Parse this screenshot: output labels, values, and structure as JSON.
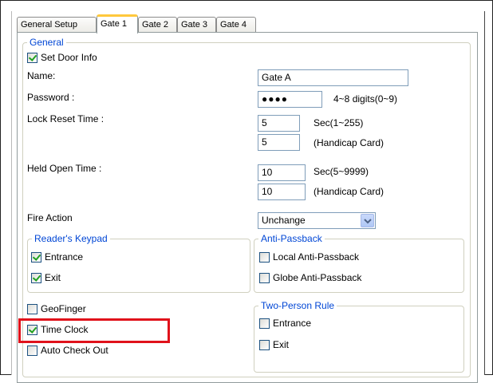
{
  "tabs": [
    "General Setup",
    "Gate 1",
    "Gate 2",
    "Gate 3",
    "Gate 4"
  ],
  "active_tab": "Gate 1",
  "general": {
    "title": "General",
    "set_door_info": {
      "label": "Set Door Info",
      "checked": true
    },
    "name": {
      "label": "Name:",
      "value": "Gate A"
    },
    "password": {
      "label": "Password :",
      "masked_value": "●●●●",
      "hint": "4~8 digits(0~9)"
    },
    "lock_reset": {
      "label": "Lock Reset Time :",
      "value": "5",
      "unit": "Sec(1~255)",
      "handicap_value": "5",
      "handicap_label": "(Handicap Card)"
    },
    "held_open": {
      "label": "Held Open Time :",
      "value": "10",
      "unit": "Sec(5~9999)",
      "handicap_value": "10",
      "handicap_label": "(Handicap Card)"
    },
    "fire_action": {
      "label": "Fire Action",
      "selected": "Unchange"
    }
  },
  "readers_keypad": {
    "title": "Reader's Keypad",
    "entrance": {
      "label": "Entrance",
      "checked": true
    },
    "exit": {
      "label": "Exit",
      "checked": true
    }
  },
  "anti_passback": {
    "title": "Anti-Passback",
    "local": {
      "label": "Local Anti-Passback",
      "checked": false
    },
    "globe": {
      "label": "Globe Anti-Passback",
      "checked": false
    }
  },
  "misc": {
    "geofinger": {
      "label": "GeoFinger",
      "checked": false
    },
    "time_clock": {
      "label": "Time Clock",
      "checked": true
    },
    "auto_check_out": {
      "label": "Auto Check Out",
      "checked": false
    }
  },
  "two_person_rule": {
    "title": "Two-Person Rule",
    "entrance": {
      "label": "Entrance",
      "checked": false
    },
    "exit": {
      "label": "Exit",
      "checked": false
    }
  },
  "colors": {
    "group_title": "#0046d5",
    "highlight": "#e0121b",
    "active_tab_accent": "#ffc83c"
  }
}
